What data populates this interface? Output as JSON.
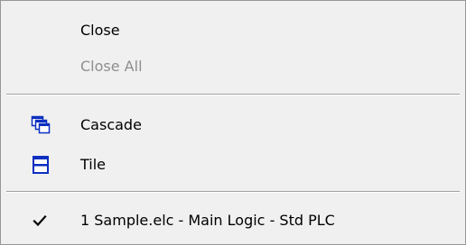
{
  "menu": {
    "items": [
      {
        "label": "Close",
        "enabled": true
      },
      {
        "label": "Close All",
        "enabled": false
      },
      {
        "label": "Cascade",
        "enabled": true,
        "icon": "cascade-windows-icon"
      },
      {
        "label": "Tile",
        "enabled": true,
        "icon": "tile-windows-icon"
      },
      {
        "label": "1 Sample.elc - Main Logic - Std PLC",
        "enabled": true,
        "checked": true,
        "icon": "checkmark-icon"
      }
    ]
  },
  "colors": {
    "icon_blue": "#0b2fc0",
    "disabled_text": "#8e8e8e",
    "background": "#f0f0f0"
  }
}
